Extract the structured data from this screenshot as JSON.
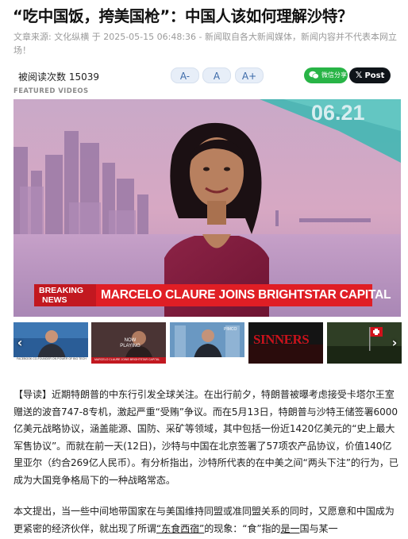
{
  "article": {
    "title": "“吃中国饭，挎美国枪”：中国人该如何理解沙特？",
    "source_label": "文章来源: ",
    "source_name": "文化纵横",
    "meta_rest": " 于 2025-05-15 06:48:36 - 新闻取自各大新闻媒体，新闻内容并不代表本网立场！"
  },
  "toolbar": {
    "views_label": "被阅读次数 15039",
    "font_smaller": "A-",
    "font_normal": "A",
    "font_larger": "A+",
    "wechat_share": "微信分享",
    "x_post": "Post",
    "x_icon": "x-logo-icon"
  },
  "featured": {
    "label": "FEATURED VIDEOS",
    "video": {
      "breaking_line1": "BREAKING",
      "breaking_line2": "NEWS",
      "headline": "MARCELO CLAURE JOINS BRIGHTSTAR CAPITAL",
      "date_badge": "06.21"
    },
    "thumbnails": [
      {
        "caption": "FACEBOOK CO-FOUNDER ON POWER OF BIG TECH"
      },
      {
        "caption": "NOW PLAYING",
        "caption2": "MARCELO CLAURE JOINS BRIGHTSTAR CAPITAL"
      },
      {
        "caption": "PIMCO"
      },
      {
        "caption": "SINNERS"
      },
      {
        "caption": ""
      }
    ],
    "prev_icon": "chevron-left-icon",
    "next_icon": "chevron-right-icon"
  },
  "body": {
    "p1_a": "【导读】近期特朗普的中东行引发全球关注。在出行前夕，特朗普被曝考虑接受卡塔尔王室赠送的波音747-8专机，激起严重“受贿”争议。而在5月13日，特朗普与沙特王储签署6000亿美元战略协议，涵盖能源、国防、采矿等领域，其中包括一份近1420亿美元的",
    "p1_link": "“史上最大军售协议”",
    "p1_b": "。而就在前一天(12日)，沙特与中国在北京签署了57项农产品协议，价值140亿里亚尔（约合269亿人民币）。有分析指出，沙特所代表的在中美之间“两头下注”的行为，已成为大国竞争格局下的一种战略常态。",
    "p2_a": "本文提出，当一些中间地带国家在与美国维持同盟或准同盟关系的同时，又愿意和中国成为更紧密的经济伙伴，就出现了所谓",
    "p2_link": "“东食西宿”",
    "p2_b": "的现象：“食”指的",
    "p2_link2": "是一",
    "p2_c": "国与某一"
  }
}
